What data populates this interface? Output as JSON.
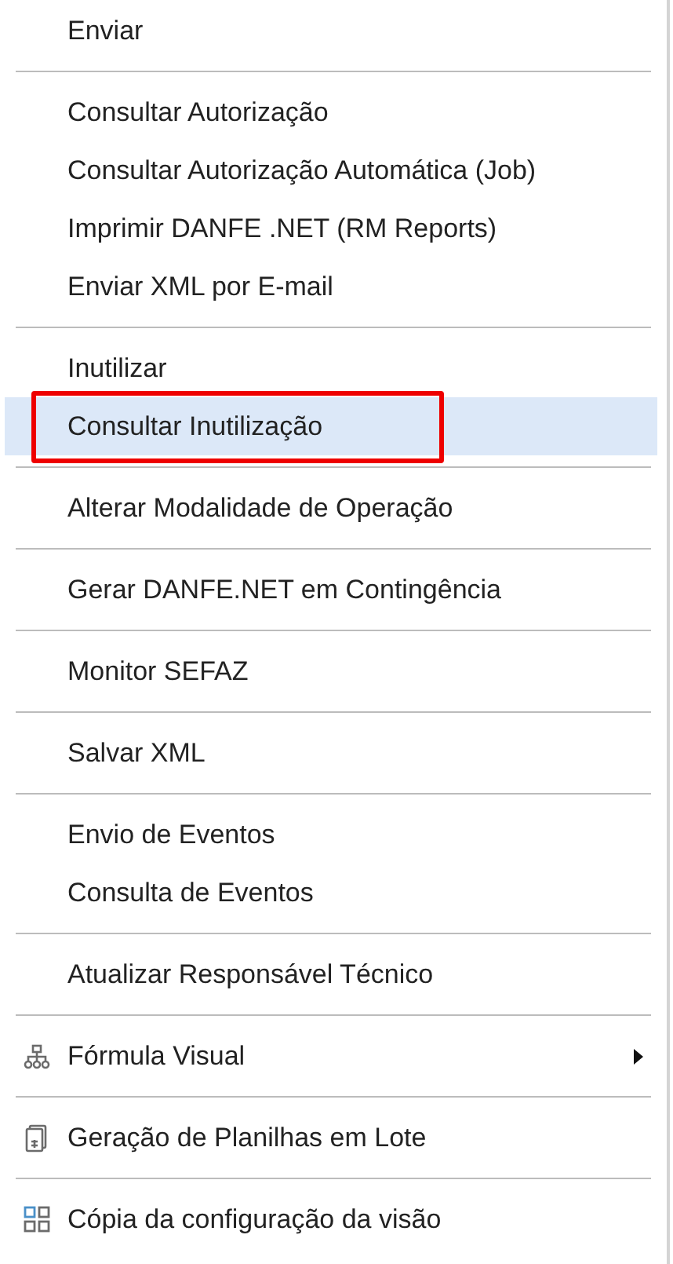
{
  "menu": {
    "groups": [
      {
        "items": [
          {
            "label": "Enviar",
            "kind": "text",
            "selected": false,
            "submenu": false,
            "outlined": false
          }
        ]
      },
      {
        "items": [
          {
            "label": "Consultar Autorização",
            "kind": "text",
            "selected": false,
            "submenu": false,
            "outlined": false
          },
          {
            "label": "Consultar Autorização Automática (Job)",
            "kind": "text",
            "selected": false,
            "submenu": false,
            "outlined": false
          },
          {
            "label": "Imprimir DANFE .NET (RM Reports)",
            "kind": "text",
            "selected": false,
            "submenu": false,
            "outlined": false
          },
          {
            "label": "Enviar XML por E-mail",
            "kind": "text",
            "selected": false,
            "submenu": false,
            "outlined": false
          }
        ]
      },
      {
        "items": [
          {
            "label": "Inutilizar",
            "kind": "text",
            "selected": false,
            "submenu": false,
            "outlined": false
          },
          {
            "label": "Consultar Inutilização",
            "kind": "text",
            "selected": true,
            "submenu": false,
            "outlined": true
          }
        ]
      },
      {
        "items": [
          {
            "label": "Alterar Modalidade de Operação",
            "kind": "text",
            "selected": false,
            "submenu": false,
            "outlined": false
          }
        ]
      },
      {
        "items": [
          {
            "label": "Gerar DANFE.NET em Contingência",
            "kind": "text",
            "selected": false,
            "submenu": false,
            "outlined": false
          }
        ]
      },
      {
        "items": [
          {
            "label": "Monitor SEFAZ",
            "kind": "text",
            "selected": false,
            "submenu": false,
            "outlined": false
          }
        ]
      },
      {
        "items": [
          {
            "label": "Salvar XML",
            "kind": "text",
            "selected": false,
            "submenu": false,
            "outlined": false
          }
        ]
      },
      {
        "items": [
          {
            "label": "Envio de Eventos",
            "kind": "text",
            "selected": false,
            "submenu": false,
            "outlined": false
          },
          {
            "label": "Consulta de Eventos",
            "kind": "text",
            "selected": false,
            "submenu": false,
            "outlined": false
          }
        ]
      },
      {
        "items": [
          {
            "label": "Atualizar Responsável Técnico",
            "kind": "text",
            "selected": false,
            "submenu": false,
            "outlined": false
          }
        ]
      },
      {
        "items": [
          {
            "label": "Fórmula Visual",
            "kind": "hierarchy",
            "selected": false,
            "submenu": true,
            "outlined": false
          }
        ]
      },
      {
        "items": [
          {
            "label": "Geração de Planilhas em Lote",
            "kind": "sheet",
            "selected": false,
            "submenu": false,
            "outlined": false
          }
        ]
      },
      {
        "items": [
          {
            "label": "Cópia da configuração da visão",
            "kind": "grid",
            "selected": false,
            "submenu": false,
            "outlined": false
          }
        ]
      }
    ]
  }
}
